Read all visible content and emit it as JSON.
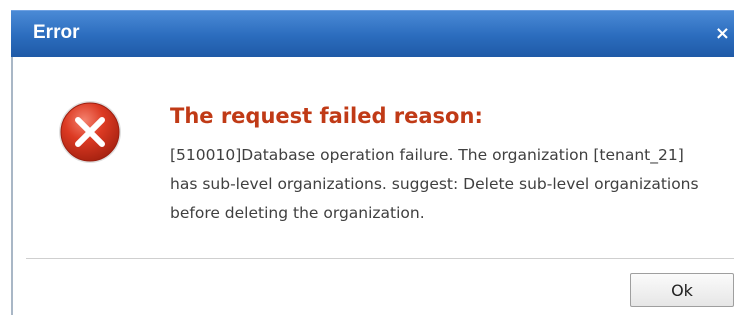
{
  "dialog": {
    "title": "Error",
    "close_icon": "×",
    "icon": "error-icon",
    "heading": "The request failed reason:",
    "message": "[510010]Database operation failure. The organization [tenant_21] has sub-level organizations. suggest: Delete sub-level organizations before deleting the organization.",
    "ok_label": "Ok"
  },
  "colors": {
    "titlebar": "#2b6cbd",
    "heading": "#c03a16",
    "error_icon": "#d9341f"
  }
}
